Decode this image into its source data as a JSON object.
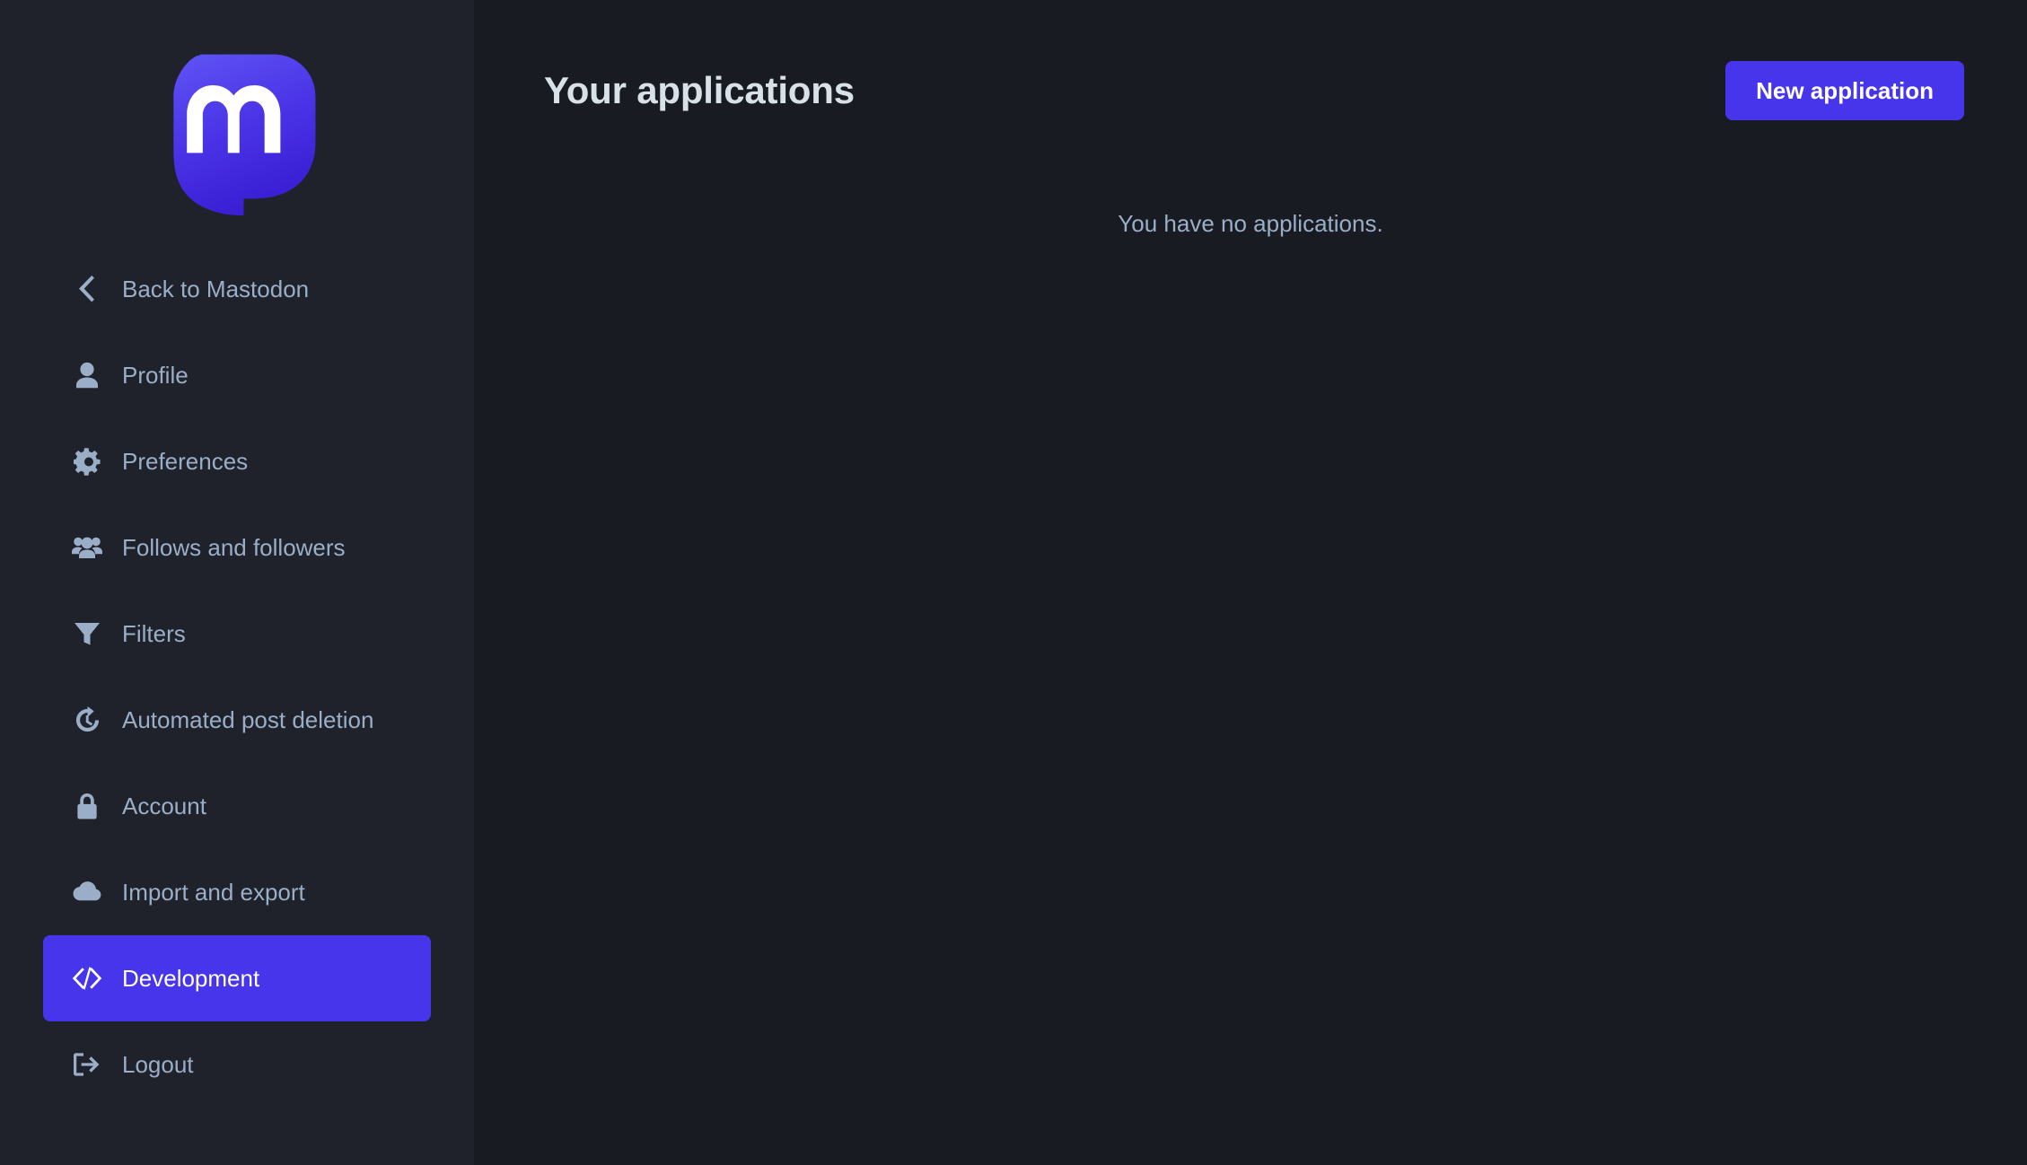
{
  "sidebar": {
    "logo": {
      "name": "mastodon-logo",
      "gradient_from": "#5a4ff3",
      "gradient_to": "#3b21d6"
    },
    "items": [
      {
        "label": "Back to Mastodon",
        "icon": "chevron-left-icon",
        "key": "back-to-mastodon",
        "active": false
      },
      {
        "label": "Profile",
        "icon": "person-icon",
        "key": "profile",
        "active": false
      },
      {
        "label": "Preferences",
        "icon": "gear-icon",
        "key": "preferences",
        "active": false
      },
      {
        "label": "Follows and followers",
        "icon": "people-group-icon",
        "key": "follows-and-followers",
        "active": false
      },
      {
        "label": "Filters",
        "icon": "funnel-icon",
        "key": "filters",
        "active": false
      },
      {
        "label": "Automated post deletion",
        "icon": "history-clock-icon",
        "key": "automated-post-deletion",
        "active": false
      },
      {
        "label": "Account",
        "icon": "lock-icon",
        "key": "account",
        "active": false
      },
      {
        "label": "Import and export",
        "icon": "cloud-download-icon",
        "key": "import-and-export",
        "active": false
      },
      {
        "label": "Development",
        "icon": "code-brackets-icon",
        "key": "development",
        "active": true
      },
      {
        "label": "Logout",
        "icon": "sign-out-icon",
        "key": "logout",
        "active": false
      }
    ]
  },
  "main": {
    "title": "Your applications",
    "new_application_button": "New application",
    "empty_message": "You have no applications."
  },
  "colors": {
    "accent": "#4735ec",
    "sidebar_bg": "#1f222b",
    "main_bg": "#191b22",
    "text_muted": "#9baec8",
    "text_bright": "#d9e1e8"
  }
}
